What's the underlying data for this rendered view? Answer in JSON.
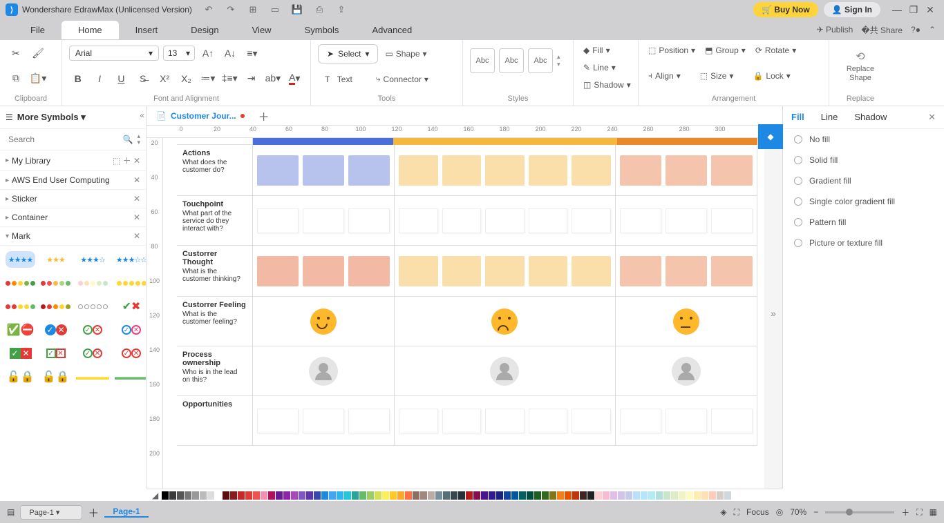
{
  "titlebar": {
    "app_title": "Wondershare EdrawMax (Unlicensed Version)",
    "buy": "Buy Now",
    "signin": "Sign In"
  },
  "menu": {
    "items": [
      "File",
      "Home",
      "Insert",
      "Design",
      "View",
      "Symbols",
      "Advanced"
    ],
    "active": "Home",
    "publish": "Publish",
    "share": "Share"
  },
  "ribbon": {
    "clipboard": "Clipboard",
    "font_align": "Font and Alignment",
    "tools": "Tools",
    "styles": "Styles",
    "arrangement": "Arrangement",
    "replace": "Replace",
    "font": "Arial",
    "size": "13",
    "select": "Select",
    "shape": "Shape",
    "text": "Text",
    "connector": "Connector",
    "abc": "Abc",
    "fill": "Fill",
    "line": "Line",
    "shadow": "Shadow",
    "position": "Position",
    "align": "Align",
    "group": "Group",
    "sizebtn": "Size",
    "rotate": "Rotate",
    "lock": "Lock",
    "replace_shape": "Replace Shape"
  },
  "left": {
    "more": "More Symbols",
    "search_ph": "Search",
    "sections": [
      "My Library",
      "AWS End User Computing",
      "Sticker",
      "Container",
      "Mark"
    ]
  },
  "doc": {
    "tab": "Customer Jour..."
  },
  "ruler_h": [
    "0",
    "20",
    "40",
    "60",
    "80",
    "100",
    "120",
    "140",
    "160",
    "180",
    "200",
    "220",
    "240",
    "260",
    "280",
    "300"
  ],
  "ruler_v": [
    "20",
    "40",
    "60",
    "80",
    "100",
    "120",
    "140",
    "160",
    "180",
    "200"
  ],
  "journey": {
    "rows": [
      {
        "title": "Actions",
        "sub": "What does the customer do?"
      },
      {
        "title": "Touchpoint",
        "sub": "What part of the service do they interact with?"
      },
      {
        "title": "Custorrer Thought",
        "sub": "What is the customer thinking?"
      },
      {
        "title": "Custorrer Feeling",
        "sub": "What is the customer feeling?"
      },
      {
        "title": "Process ownership",
        "sub": "Who is in the lead on this?"
      },
      {
        "title": "Opportunities",
        "sub": ""
      }
    ],
    "stages": [
      {
        "color": "#4a6fd8",
        "boxes": "#b7c3ec",
        "thought": "#f2b9a5"
      },
      {
        "color": "#f5b83d",
        "boxes": "#fadfab",
        "thought": "#fadfab"
      },
      {
        "color": "#e88a2a",
        "boxes": "#f4c4ac",
        "thought": "#f4c4ac"
      }
    ]
  },
  "rightpanel": {
    "tabs": [
      "Fill",
      "Line",
      "Shadow"
    ],
    "active": "Fill",
    "opts": [
      "No fill",
      "Solid fill",
      "Gradient fill",
      "Single color gradient fill",
      "Pattern fill",
      "Picture or texture fill"
    ]
  },
  "status": {
    "page": "Page-1",
    "pagetab": "Page-1",
    "focus": "Focus",
    "zoom": "70%"
  },
  "palette": [
    "#000",
    "#3a3a3a",
    "#555",
    "#777",
    "#999",
    "#bbb",
    "#ddd",
    "#fff",
    "#5b0f0f",
    "#8b1a1a",
    "#c62828",
    "#e53935",
    "#ef5350",
    "#f48fb1",
    "#ad1457",
    "#6a1b9a",
    "#8e24aa",
    "#ab47bc",
    "#7e57c2",
    "#5e35b1",
    "#3949ab",
    "#1e88e5",
    "#42a5f5",
    "#29b6f6",
    "#26c6da",
    "#26a69a",
    "#66bb6a",
    "#9ccc65",
    "#d4e157",
    "#ffee58",
    "#ffca28",
    "#ffa726",
    "#ff7043",
    "#8d6e63",
    "#a1887f",
    "#bcaaa4",
    "#78909c",
    "#546e7a",
    "#37474f",
    "#263238",
    "#b71c1c",
    "#880e4f",
    "#4a148c",
    "#311b92",
    "#1a237e",
    "#0d47a1",
    "#01579b",
    "#006064",
    "#004d40",
    "#1b5e20",
    "#33691e",
    "#827717",
    "#f57f17",
    "#e65100",
    "#bf360c",
    "#3e2723",
    "#212121",
    "#ffcdd2",
    "#f8bbd0",
    "#e1bee7",
    "#d1c4e9",
    "#c5cae9",
    "#bbdefb",
    "#b3e5fc",
    "#b2ebf2",
    "#b2dfdb",
    "#c8e6c9",
    "#dcedc8",
    "#f0f4c3",
    "#fff9c4",
    "#ffecb3",
    "#ffe0b2",
    "#ffccbc",
    "#d7ccc8",
    "#cfd8dc"
  ]
}
